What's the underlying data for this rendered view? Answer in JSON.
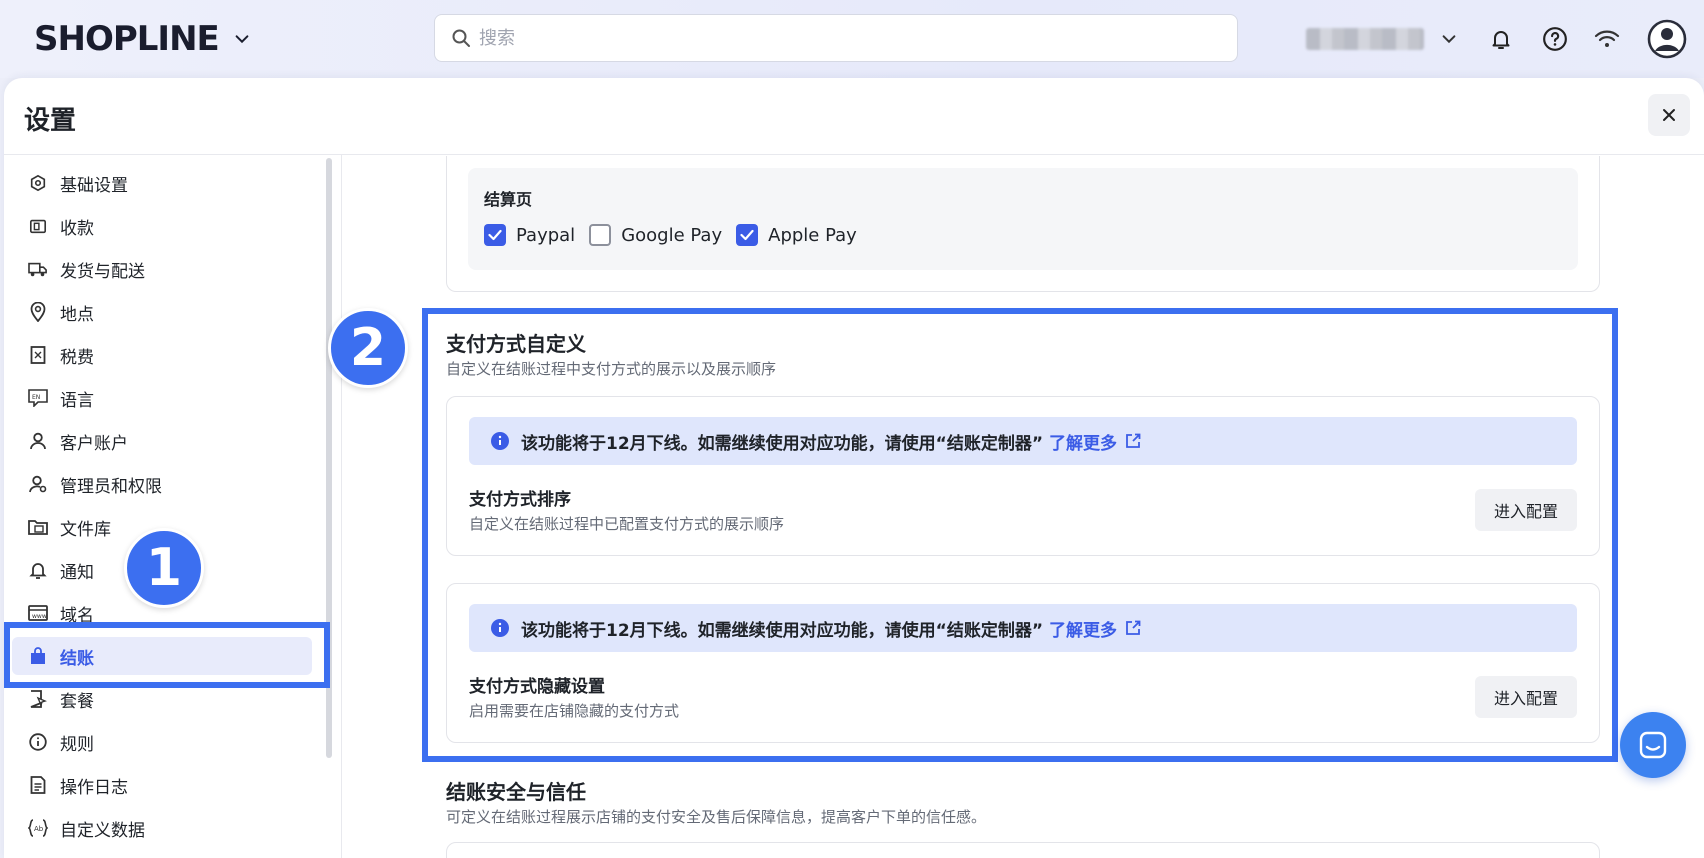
{
  "header": {
    "logo_text": "SHOPLINE",
    "search_placeholder": "搜索"
  },
  "panel": {
    "title": "设置"
  },
  "sidebar": {
    "items": [
      {
        "label": "基础设置",
        "icon": "settings-hexagon-icon"
      },
      {
        "label": "收款",
        "icon": "wallet-icon"
      },
      {
        "label": "发货与配送",
        "icon": "truck-icon"
      },
      {
        "label": "地点",
        "icon": "location-pin-icon"
      },
      {
        "label": "税费",
        "icon": "tax-receipt-icon"
      },
      {
        "label": "语言",
        "icon": "language-icon"
      },
      {
        "label": "客户账户",
        "icon": "user-icon"
      },
      {
        "label": "管理员和权限",
        "icon": "admin-user-icon"
      },
      {
        "label": "文件库",
        "icon": "folder-icon"
      },
      {
        "label": "通知",
        "icon": "bell-icon"
      },
      {
        "label": "域名",
        "icon": "domain-icon"
      },
      {
        "label": "结账",
        "icon": "shopping-bag-icon",
        "active": true
      },
      {
        "label": "套餐",
        "icon": "plan-icon"
      },
      {
        "label": "规则",
        "icon": "info-circle-icon"
      },
      {
        "label": "操作日志",
        "icon": "log-icon"
      },
      {
        "label": "自定义数据",
        "icon": "custom-data-icon"
      }
    ]
  },
  "badges": {
    "step1": "1",
    "step2": "2"
  },
  "checkout_page": {
    "label": "结算页",
    "options": [
      {
        "label": "Paypal",
        "checked": true
      },
      {
        "label": "Google Pay",
        "checked": false
      },
      {
        "label": "Apple Pay",
        "checked": true
      }
    ]
  },
  "payment_custom": {
    "title": "支付方式自定义",
    "subtitle": "自定义在结账过程中支付方式的展示以及展示顺序",
    "cards": [
      {
        "notice": "该功能将于12月下线。如需继续使用对应功能，请使用“结账定制器”",
        "learn_more": "了解更多",
        "title": "支付方式排序",
        "subtitle": "自定义在结账过程中已配置支付方式的展示顺序",
        "button": "进入配置"
      },
      {
        "notice": "该功能将于12月下线。如需继续使用对应功能，请使用“结账定制器”",
        "learn_more": "了解更多",
        "title": "支付方式隐藏设置",
        "subtitle": "启用需要在店铺隐藏的支付方式",
        "button": "进入配置"
      }
    ]
  },
  "security": {
    "title": "结账安全与信任",
    "subtitle": "可定义在结账过程展示店铺的支付安全及售后保障信息，提高客户下单的信任感。"
  },
  "colors": {
    "accent": "#3b5ce6",
    "highlight": "#3c6ff0",
    "notice_bg": "#dfe6fc"
  }
}
